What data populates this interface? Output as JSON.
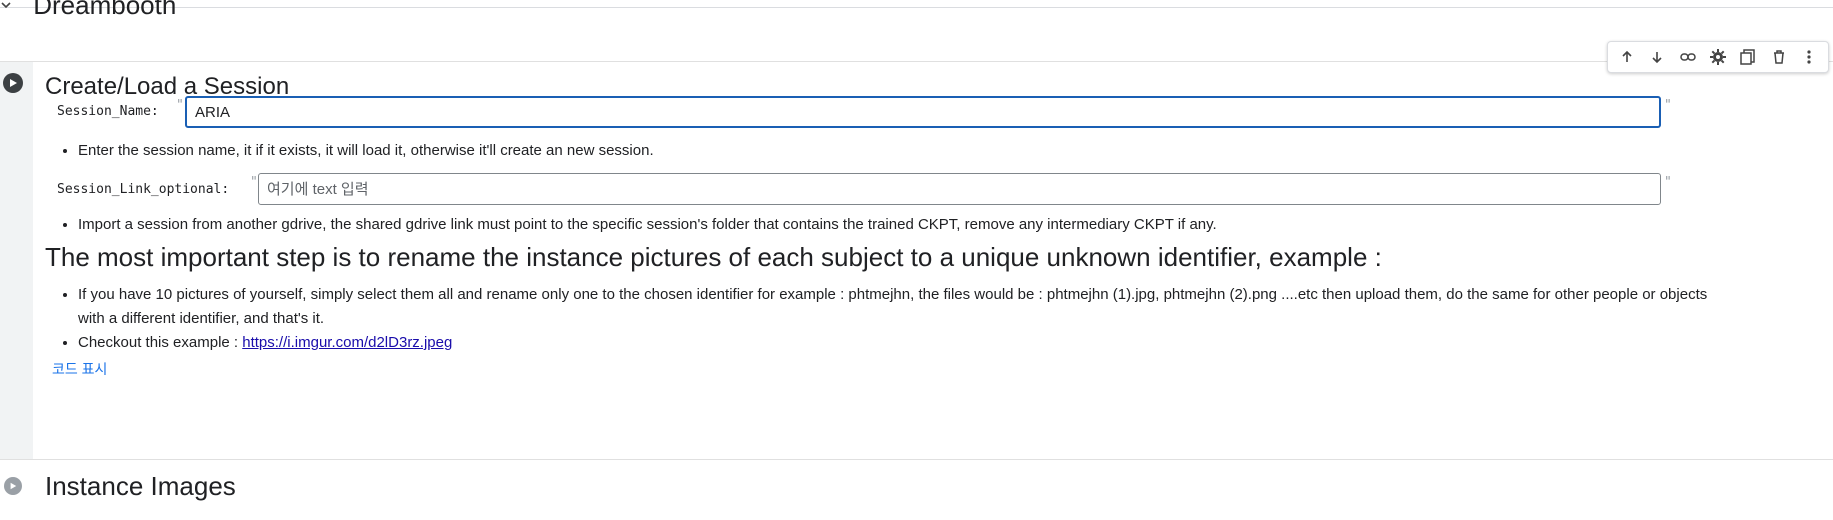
{
  "section": {
    "title": "Dreambooth"
  },
  "cell": {
    "title": "Create/Load a Session",
    "toolbar": {
      "icons": [
        "arrow-up-icon",
        "arrow-down-icon",
        "link-icon",
        "gear-icon",
        "mirror-cell-icon",
        "trash-icon",
        "more-vert-icon"
      ]
    },
    "params": {
      "session_name": {
        "label": "Session_Name:",
        "value": "ARIA"
      },
      "session_link": {
        "label": "Session_Link_optional:",
        "value": "",
        "placeholder": "여기에 text 입력"
      }
    },
    "notes": {
      "session_name_hint": "Enter the session name, it if it exists, it will load it, otherwise it'll create an new session.",
      "session_link_hint": "Import a session from another gdrive, the shared gdrive link must point to the specific session's folder that contains the trained CKPT, remove any intermediary CKPT if any."
    },
    "heading": "The most important step is to rename the instance pictures of each subject to a unique unknown identifier, example :",
    "bullets": {
      "rename_tip": "If you have 10 pictures of yourself, simply select them all and rename only one to the chosen identifier for example : phtmejhn, the files would be : phtmejhn (1).jpg, phtmejhn (2).png ....etc then upload them, do the same for other people or objects with a different identifier, and that's it.",
      "example_prefix": "Checkout this example : ",
      "example_link": "https://i.imgur.com/d2lD3rz.jpeg"
    },
    "show_code": "코드 표시"
  },
  "next_cell": {
    "title": "Instance Images"
  },
  "colors": {
    "accent": "#1a5fb4",
    "link": "#1a0dab",
    "show_code": "#1a73e8",
    "gutter": "#f1f3f4"
  }
}
